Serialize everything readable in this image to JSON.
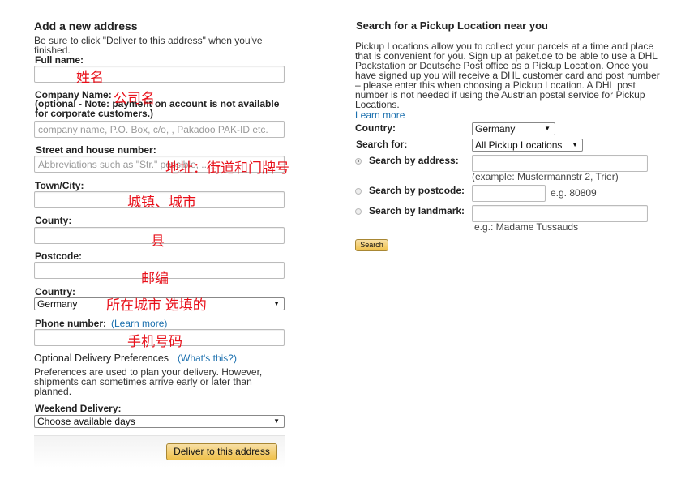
{
  "address_form": {
    "title": "Add a new address",
    "intro": "Be sure to click \"Deliver to this address\" when you've finished.",
    "full_name": {
      "label": "Full name:",
      "value": "",
      "annotation": "姓名"
    },
    "company": {
      "label": "Company Name:",
      "note": "(optional - Note: payment on account is not available for corporate customers.)",
      "placeholder": "company name, P.O. Box, c/o, , Pakadoo PAK-ID etc.",
      "annotation": "公司名"
    },
    "street": {
      "label": "Street and house number:",
      "placeholder": "Abbreviations such as \"Str.\" possible, ...",
      "annotation": "地址：街道和门牌号"
    },
    "town": {
      "label": "Town/City:",
      "annotation": "城镇、城市"
    },
    "county": {
      "label": "County:",
      "annotation": "县"
    },
    "postcode": {
      "label": "Postcode:",
      "annotation": "邮编"
    },
    "country": {
      "label": "Country:",
      "value": "Germany",
      "annotation": "所在城市 选填的"
    },
    "phone": {
      "label": "Phone number:",
      "link": "(Learn more)",
      "annotation": "手机号码"
    },
    "preferences": {
      "title": "Optional Delivery Preferences",
      "link": "(What's this?)",
      "text": "Preferences are used to plan your delivery. However, shipments can sometimes arrive early or later than planned."
    },
    "weekend": {
      "label": "Weekend Delivery:",
      "value": "Choose available days"
    },
    "submit": "Deliver to this address"
  },
  "pickup": {
    "title": "Search for a Pickup Location near you",
    "text": "Pickup Locations allow you to collect your parcels at a time and place that is convenient for you. Sign up at paket.de to be able to use a DHL Packstation or Deutsche Post office as a Pickup Location. Once you have signed up you will receive a DHL customer card and post number – please enter this when choosing a Pickup Location. A DHL post number is not needed if using the Austrian postal service for Pickup Locations.",
    "learn_more": "Learn more",
    "country": {
      "label": "Country:",
      "value": "Germany"
    },
    "search_for": {
      "label": "Search for:",
      "value": "All Pickup Locations"
    },
    "by_address": {
      "label": "Search by address:",
      "hint": "(example: Mustermannstr 2, Trier)",
      "selected": true
    },
    "by_postcode": {
      "label": "Search by postcode:",
      "hint": "e.g. 80809",
      "selected": false
    },
    "by_landmark": {
      "label": "Search by landmark:",
      "hint": "e.g.: Madame Tussauds",
      "selected": false
    },
    "search_button": "Search"
  }
}
